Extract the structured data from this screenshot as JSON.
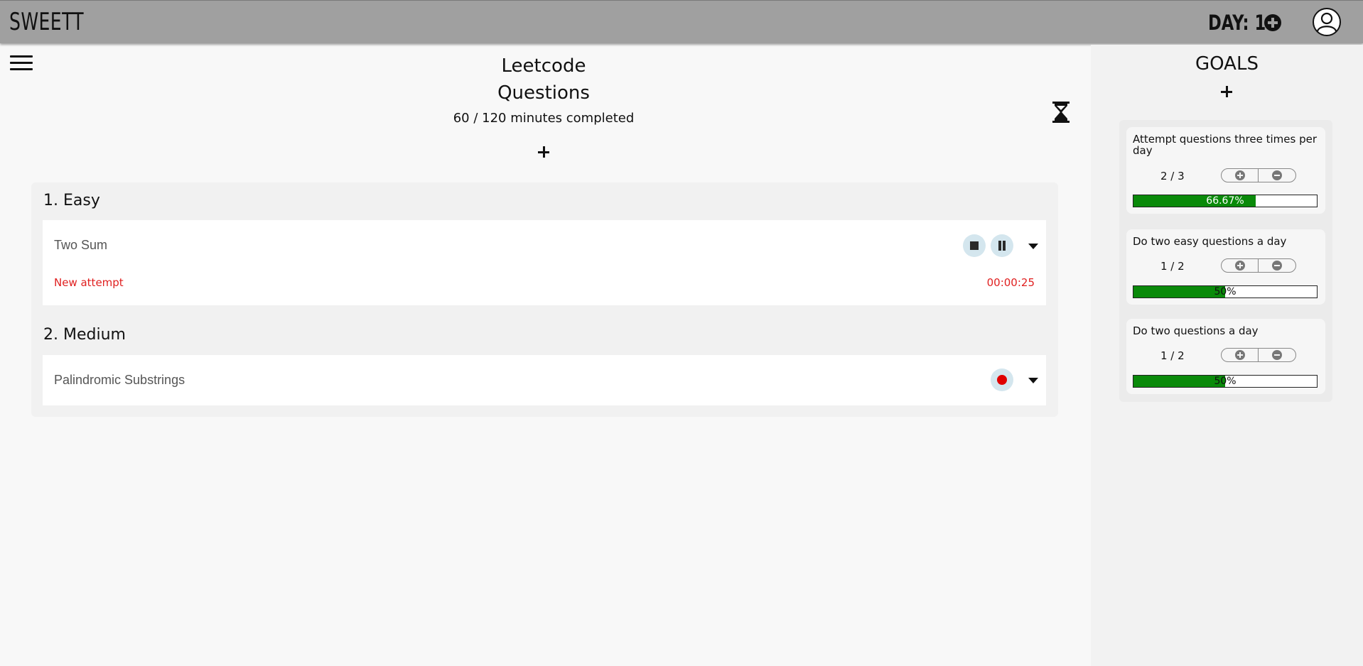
{
  "app": {
    "brand": "SWEETT",
    "day_label": "DAY: 14"
  },
  "main": {
    "title_line1": "Leetcode",
    "title_line2": "Questions",
    "minutes_text": "60 / 120 minutes completed",
    "categories": [
      {
        "title": "1. Easy",
        "questions": [
          {
            "name": "Two Sum",
            "attempt_label": "New attempt",
            "timer": "00:00:25",
            "controls": [
              "stop-icon",
              "pause-icon"
            ]
          }
        ]
      },
      {
        "title": "2. Medium",
        "questions": [
          {
            "name": "Palindromic Substrings",
            "controls": [
              "record-icon"
            ]
          }
        ]
      }
    ]
  },
  "goals": {
    "title": "GOALS",
    "items": [
      {
        "title": "Attempt questions three times per day",
        "count": "2 / 3",
        "percent_label": "66.67%",
        "progress": 0.6667
      },
      {
        "title": "Do two easy questions a day",
        "count": "1 / 2",
        "percent_label": "50%",
        "progress": 0.5
      },
      {
        "title": "Do two questions a day",
        "count": "1 / 2",
        "percent_label": "50%",
        "progress": 0.5
      }
    ]
  },
  "colors": {
    "topbar": "#a0a0a0",
    "progress_fill": "#0a8a0a",
    "attempt_text": "#e02020",
    "control_bg": "#d4e6ee"
  }
}
